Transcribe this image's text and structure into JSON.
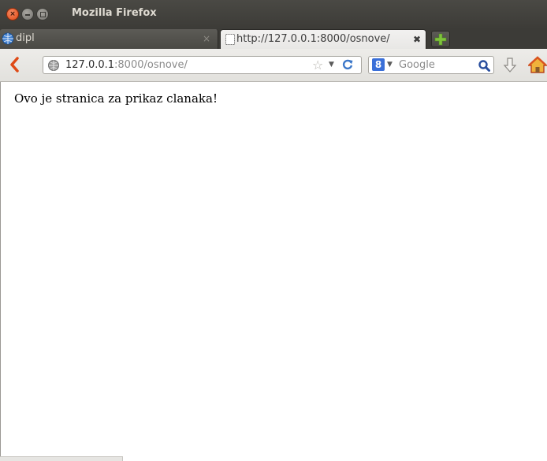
{
  "window": {
    "title": "Mozilla Firefox"
  },
  "tabs": [
    {
      "label": "dipl",
      "active": false
    },
    {
      "label": "http://127.0.0.1:8000/osnove/",
      "active": true
    }
  ],
  "tab_close_glyph": "×",
  "tab_close_active_glyph": "✖",
  "address": {
    "host": "127.0.0.1",
    "path": ":8000/osnove/"
  },
  "search": {
    "placeholder": "Google",
    "engine_glyph": "8"
  },
  "page": {
    "text": "Ovo je stranica za prikaz clanaka!"
  },
  "icons": {
    "back": "back-arrow-icon",
    "site": "globe-icon",
    "bookmark": "star-icon",
    "reload": "reload-icon",
    "search_engine": "google-icon",
    "search": "magnifier-icon",
    "downloads": "download-arrow-icon",
    "home": "home-icon",
    "new_tab": "plus-icon",
    "favicon": "globe-favicon-icon",
    "blank_page": "blank-page-icon"
  },
  "colors": {
    "titlebar": "#3c3b37",
    "accent": "#df4a16",
    "new_tab_plus": "#7ec23c"
  }
}
